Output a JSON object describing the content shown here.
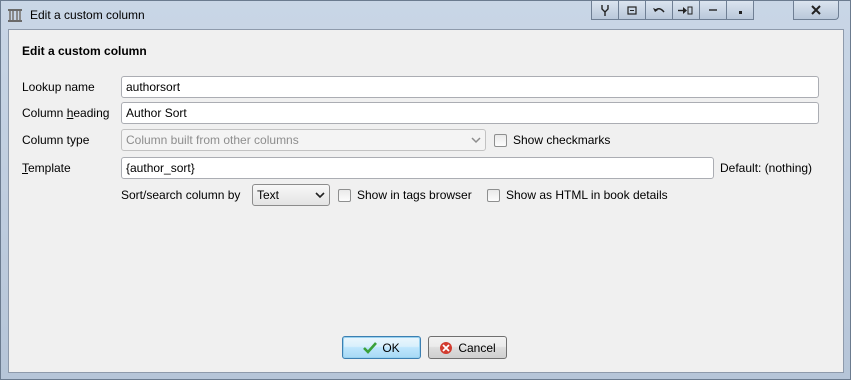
{
  "window": {
    "title": "Edit a custom column"
  },
  "titlebar_buttons": [
    "pin-icon",
    "restore-small-icon",
    "undo-icon",
    "shade-icon",
    "minimize-icon",
    "maximize-icon",
    "close-icon"
  ],
  "dialog": {
    "heading": "Edit a custom column",
    "lookup_name": {
      "label": "Lookup name",
      "value": "authorsort"
    },
    "column_heading": {
      "label_pre": "Column ",
      "label_u": "h",
      "label_post": "eading",
      "value": "Author Sort"
    },
    "column_type": {
      "label": "Column type",
      "value": "Column built from other columns"
    },
    "show_checkmarks": {
      "label": "Show checkmarks",
      "checked": false
    },
    "template": {
      "label_u": "T",
      "label_post": "emplate",
      "value": "{author_sort}",
      "default_text": "Default: (nothing)"
    },
    "sort_search": {
      "label_pre": "Sort/search column by",
      "value": "Text"
    },
    "show_in_tags_browser": {
      "label": "Show in tags browser",
      "checked": false
    },
    "show_as_html": {
      "label": "Show as HTML in book details",
      "checked": false
    }
  },
  "buttons": {
    "ok": "OK",
    "cancel": "Cancel"
  },
  "colors": {
    "ok_check": "#3aa13a",
    "cancel_icon": "#d23b2f"
  }
}
